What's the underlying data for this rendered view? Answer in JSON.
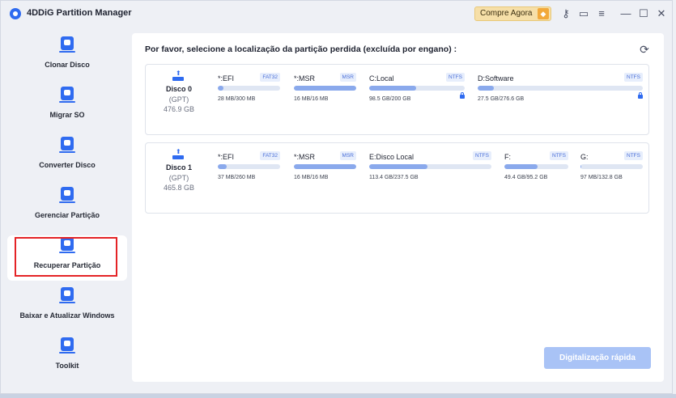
{
  "app": {
    "title": "4DDiG Partition Manager",
    "buy_label": "Compre Agora",
    "icons": [
      "key-icon",
      "feedback-icon",
      "menu-icon",
      "minimize-icon",
      "maximize-icon",
      "close-icon"
    ]
  },
  "sidebar": {
    "items": [
      {
        "label": "Clonar Disco",
        "icon": "clone-disk-icon"
      },
      {
        "label": "Migrar SO",
        "icon": "migrate-os-icon"
      },
      {
        "label": "Converter Disco",
        "icon": "convert-disk-icon"
      },
      {
        "label": "Gerenciar Partição",
        "icon": "manage-partition-icon"
      },
      {
        "label": "Recuperar Partição",
        "icon": "recover-partition-icon"
      },
      {
        "label": "Baixar e Atualizar Windows",
        "icon": "download-windows-icon"
      },
      {
        "label": "Toolkit",
        "icon": "toolkit-icon"
      }
    ],
    "active_index": 4
  },
  "main": {
    "title": "Por favor, selecione a localização da partição perdida (excluída por engano) :",
    "disks": [
      {
        "name": "Disco 0",
        "type": "(GPT)",
        "size": "476.9 GB",
        "partitions": [
          {
            "name": "*:EFI",
            "fs": "FAT32",
            "usage": "28 MB/300 MB",
            "fill": 0.09,
            "locked": false
          },
          {
            "name": "*:MSR",
            "fs": "MSR",
            "usage": "16 MB/16 MB",
            "fill": 1.0,
            "locked": false
          },
          {
            "name": "C:Local",
            "fs": "NTFS",
            "usage": "98.5 GB/200 GB",
            "fill": 0.49,
            "locked": true
          },
          {
            "name": "D:Software",
            "fs": "NTFS",
            "usage": "27.5 GB/276.6 GB",
            "fill": 0.1,
            "locked": true
          }
        ]
      },
      {
        "name": "Disco 1",
        "type": "(GPT)",
        "size": "465.8 GB",
        "partitions": [
          {
            "name": "*:EFI",
            "fs": "FAT32",
            "usage": "37 MB/260 MB",
            "fill": 0.14,
            "locked": false
          },
          {
            "name": "*:MSR",
            "fs": "MSR",
            "usage": "16 MB/16 MB",
            "fill": 1.0,
            "locked": false
          },
          {
            "name": "E:Disco Local",
            "fs": "NTFS",
            "usage": "113.4 GB/237.5 GB",
            "fill": 0.48,
            "locked": false
          },
          {
            "name": "F:",
            "fs": "NTFS",
            "usage": "49.4 GB/95.2 GB",
            "fill": 0.52,
            "locked": false
          },
          {
            "name": "G:",
            "fs": "NTFS",
            "usage": "97 MB/132.8 GB",
            "fill": 0.01,
            "locked": false
          }
        ]
      }
    ],
    "scan_label": "Digitalização rápida"
  }
}
